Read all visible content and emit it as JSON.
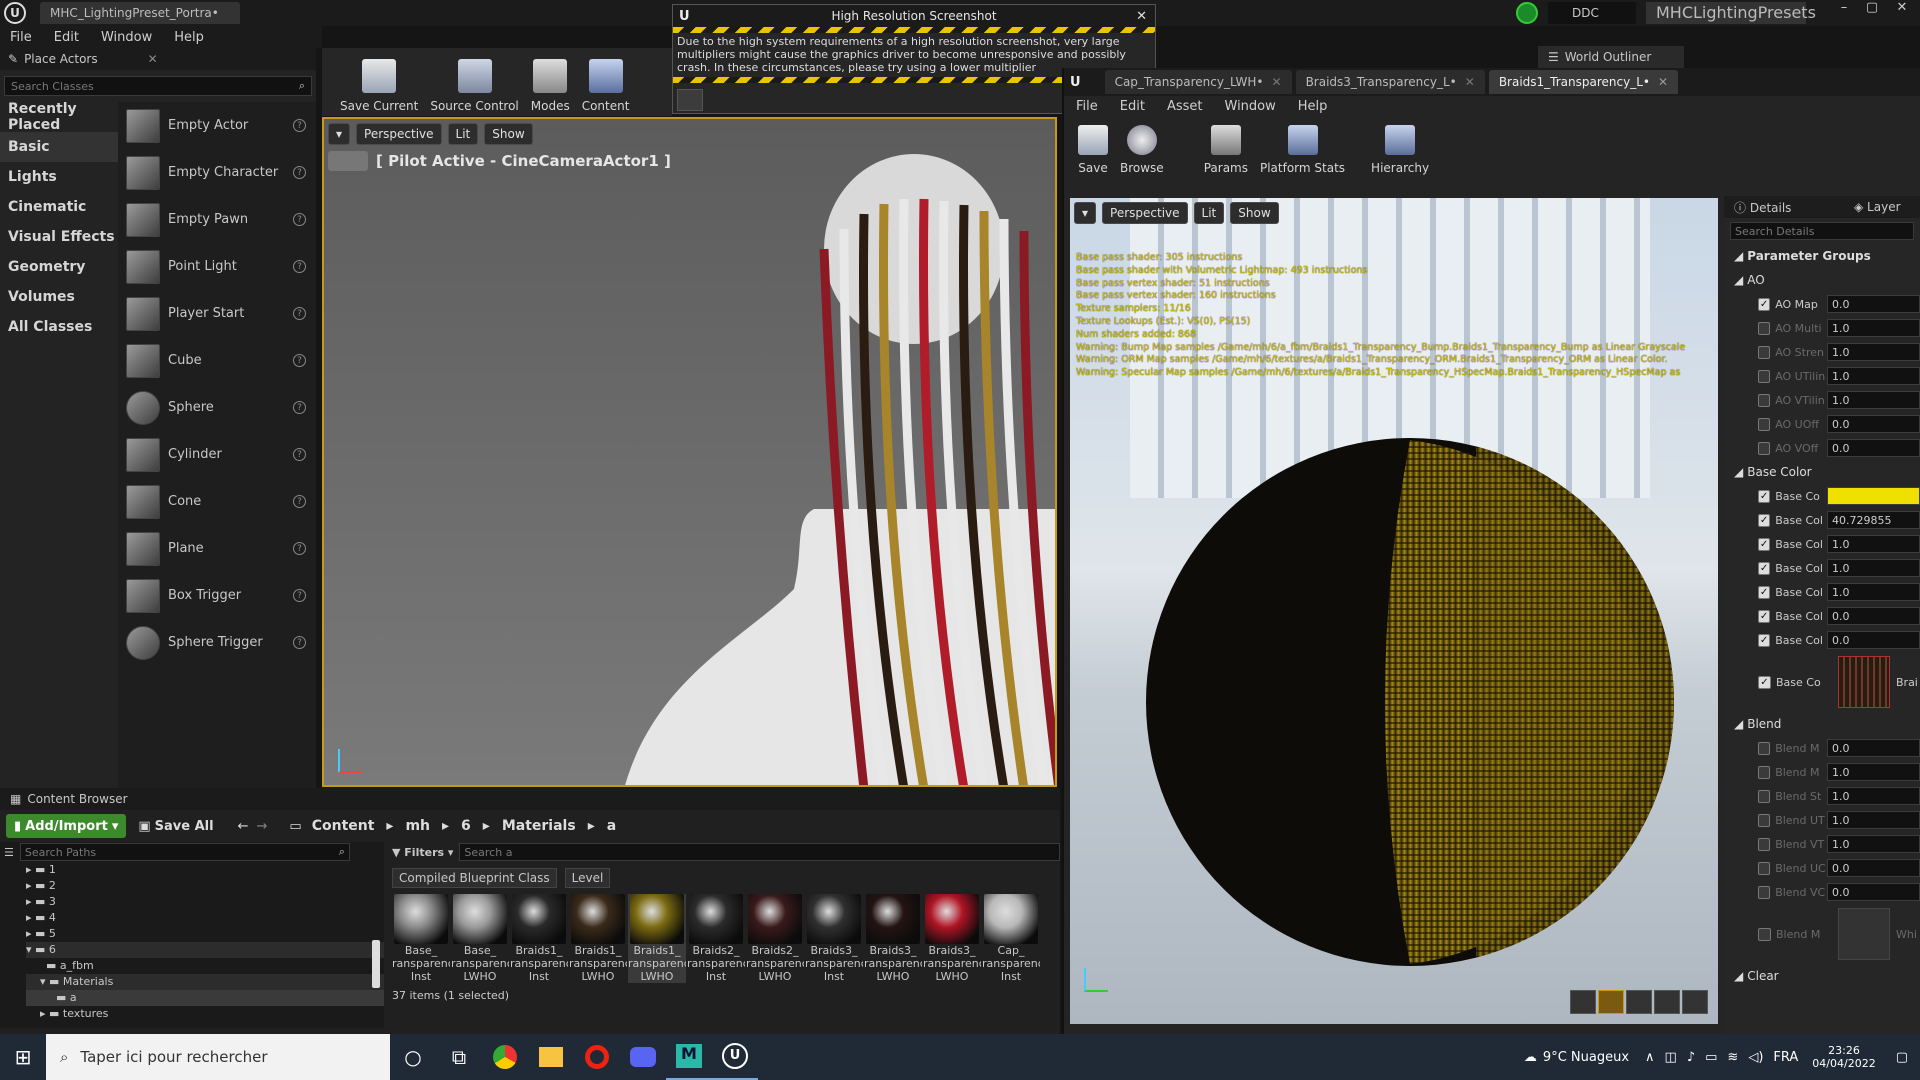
{
  "titlebar": {
    "logo": "unreal-logo",
    "doc_tab": "MHC_LightingPreset_Portra•",
    "ddc_label": "DDC",
    "project_name": "MHCLightingPresets",
    "world_outliner": "World Outliner"
  },
  "menus": [
    "File",
    "Edit",
    "Window",
    "Help"
  ],
  "place_actors": {
    "title": "Place Actors",
    "search_placeholder": "Search Classes",
    "categories": [
      "Recently Placed",
      "Basic",
      "Lights",
      "Cinematic",
      "Visual Effects",
      "Geometry",
      "Volumes",
      "All Classes"
    ],
    "selected_category": "Basic",
    "actors": [
      "Empty Actor",
      "Empty Character",
      "Empty Pawn",
      "Point Light",
      "Player Start",
      "Cube",
      "Sphere",
      "Cylinder",
      "Cone",
      "Plane",
      "Box Trigger",
      "Sphere Trigger"
    ]
  },
  "toolbar": {
    "buttons": [
      "Save Current",
      "Source Control",
      "Modes",
      "Content"
    ]
  },
  "screenshot_dialog": {
    "title": "High Resolution Screenshot",
    "message": "Due to the high system requirements of a high resolution screenshot, very large multipliers might cause the graphics driver to become unresponsive and possibly crash. In these circumstances, please try using a lower multiplier"
  },
  "viewport": {
    "perspective": "Perspective",
    "lit": "Lit",
    "show": "Show",
    "pilot_label": "[ Pilot Active - CineCameraActor1 ]"
  },
  "content_browser": {
    "title": "Content Browser",
    "add_import": "Add/Import",
    "save_all": "Save All",
    "breadcrumb": [
      "Content",
      "mh",
      "6",
      "Materials",
      "a"
    ],
    "search_paths_placeholder": "Search Paths",
    "filters_label": "Filters",
    "search_placeholder": "Search a",
    "filter_chips": [
      "Compiled Blueprint Class",
      "Level"
    ],
    "folders": [
      "1",
      "2",
      "3",
      "4",
      "5",
      "6",
      "a_fbm",
      "Materials",
      "a",
      "textures"
    ],
    "assets": [
      {
        "name": "Base_ ransparenc Inst",
        "color": "#8a8a8a"
      },
      {
        "name": "Base_ ransparenc LWHO",
        "color": "#9a9a9a"
      },
      {
        "name": "Braids1_ ransparenc Inst",
        "color": "#2a2a2a"
      },
      {
        "name": "Braids1_ ransparenc LWHO",
        "color": "#3a2a1a"
      },
      {
        "name": "Braids1_ ransparenc LWHO",
        "color": "#7a6a10"
      },
      {
        "name": "Braids2_ ransparenc Inst",
        "color": "#2b2b2b"
      },
      {
        "name": "Braids2_ ransparenc LWHO",
        "color": "#3a1a1a"
      },
      {
        "name": "Braids3_ ransparenc Inst",
        "color": "#303030"
      },
      {
        "name": "Braids3_ ransparenc LWHO",
        "color": "#241414"
      },
      {
        "name": "Braids3_ ransparenc LWHO",
        "color": "#b01424"
      },
      {
        "name": "Cap_ ransparenc Inst",
        "color": "#b8b8b8"
      }
    ],
    "status": "37 items (1 selected)"
  },
  "material_editor": {
    "tabs": [
      "Cap_Transparency_LWH•",
      "Braids3_Transparency_L•",
      "Braids1_Transparency_L•"
    ],
    "menus": [
      "File",
      "Edit",
      "Asset",
      "Window",
      "Help"
    ],
    "toolbar": [
      "Save",
      "Browse",
      "Params",
      "Platform Stats",
      "Hierarchy"
    ],
    "viewport": {
      "perspective": "Perspective",
      "lit": "Lit",
      "show": "Show"
    },
    "stats": [
      "Base pass shader: 305 instructions",
      "Base pass shader with Volumetric Lightmap: 493 instructions",
      "Base pass vertex shader: 51 instructions",
      "Base pass vertex shader: 160 instructions",
      "Texture samplers: 11/16",
      "Texture Lookups (Est.): VS(0), PS(15)",
      "Num shaders added: 868",
      "Warning: Bump Map samples /Game/mh/6/a_fbm/Braids1_Transparency_Bump.Braids1_Transparency_Bump as Linear Grayscale",
      "Warning: ORM Map samples /Game/mh/6/textures/a/Braids1_Transparency_ORM.Braids1_Transparency_ORM as Linear Color.",
      "Warning: Specular Map samples /Game/mh/6/textures/a/Braids1_Transparency_HSpecMap.Braids1_Transparency_HSpecMap as"
    ]
  },
  "details": {
    "title": "Details",
    "layers_tab": "Layer",
    "search_placeholder": "Search Details",
    "parameter_groups": "Parameter Groups",
    "groups": [
      {
        "name": "AO",
        "rows": [
          {
            "label": "AO Map",
            "value": "0.0",
            "on": true
          },
          {
            "label": "AO Multi",
            "value": "1.0",
            "on": false
          },
          {
            "label": "AO Stren",
            "value": "1.0",
            "on": false
          },
          {
            "label": "AO UTilin",
            "value": "1.0",
            "on": false
          },
          {
            "label": "AO VTilin",
            "value": "1.0",
            "on": false
          },
          {
            "label": "AO UOff",
            "value": "0.0",
            "on": false
          },
          {
            "label": "AO VOff",
            "value": "0.0",
            "on": false
          }
        ]
      },
      {
        "name": "Base Color",
        "rows": [
          {
            "label": "Base Co",
            "value": "",
            "on": true,
            "swatch": "#f0e000"
          },
          {
            "label": "Base Col",
            "value": "40.729855",
            "on": true
          },
          {
            "label": "Base Col",
            "value": "1.0",
            "on": true
          },
          {
            "label": "Base Col",
            "value": "1.0",
            "on": true
          },
          {
            "label": "Base Col",
            "value": "1.0",
            "on": true
          },
          {
            "label": "Base Col",
            "value": "0.0",
            "on": true
          },
          {
            "label": "Base Col",
            "value": "0.0",
            "on": true
          }
        ]
      },
      {
        "name": "Blend",
        "rows": [
          {
            "label": "Blend M",
            "value": "0.0",
            "on": false
          },
          {
            "label": "Blend M",
            "value": "1.0",
            "on": false
          },
          {
            "label": "Blend St",
            "value": "1.0",
            "on": false
          },
          {
            "label": "Blend UT",
            "value": "1.0",
            "on": false
          },
          {
            "label": "Blend VT",
            "value": "1.0",
            "on": false
          },
          {
            "label": "Blend UC",
            "value": "0.0",
            "on": false
          },
          {
            "label": "Blend VC",
            "value": "0.0",
            "on": false
          }
        ]
      }
    ],
    "texture_row_label": "Base Co",
    "texture_name": "Brai",
    "blend_tex_label": "Blend M",
    "blend_tex_name": "Whi",
    "next_group": "Clear"
  },
  "taskbar": {
    "search_placeholder": "Taper ici pour rechercher",
    "weather": "9°C Nuageux",
    "language": "FRA",
    "time": "23:26",
    "date": "04/04/2022"
  }
}
